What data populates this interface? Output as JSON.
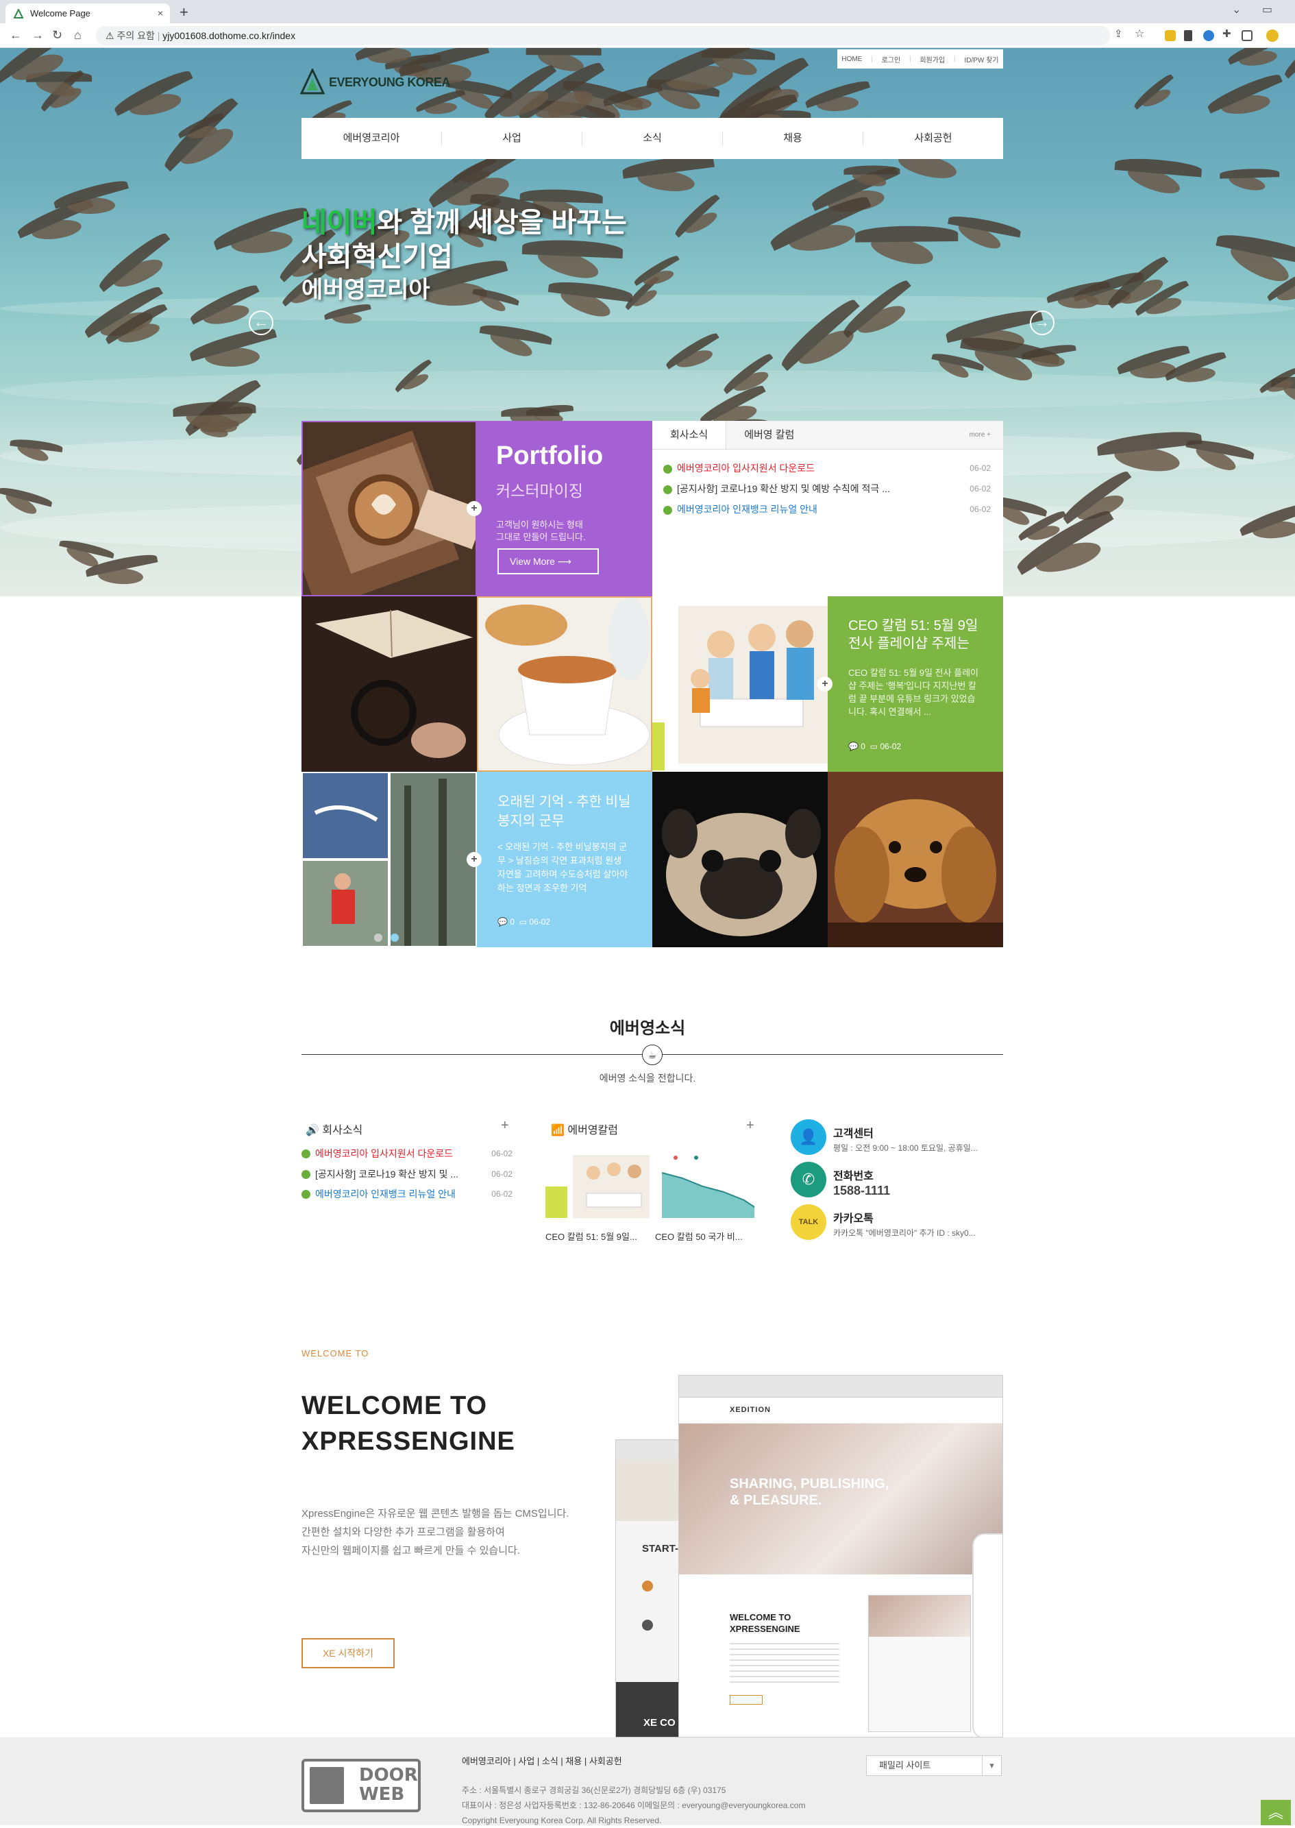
{
  "browser": {
    "tab_title": "Welcome Page",
    "close": "×",
    "new_tab": "+",
    "security_label": "주의 요함",
    "url": "yjy001608.dothome.co.kr/index",
    "nav_icons": [
      "back-icon",
      "forward-icon",
      "reload-icon",
      "home-icon"
    ],
    "window_icons": [
      "minimize-icon",
      "restore-icon"
    ]
  },
  "top_util": [
    "HOME",
    "로그인",
    "회원가입",
    "ID/PW 찾기"
  ],
  "logo_text": "EVERYOUNG KOREA",
  "gnb": [
    "에버영코리아",
    "사업",
    "소식",
    "채용",
    "사회공헌"
  ],
  "slogan": {
    "naver": "네이버",
    "line1_rest": "와 함께 세상을 바꾸는",
    "line2": "사회혁신기업",
    "line3": "에버영코리아"
  },
  "slider": {
    "prev": "←",
    "next": "→"
  },
  "portfolio": {
    "title": "Portfolio",
    "subtitle": "커스터마이징",
    "desc_line1": "고객님이 원하시는 형태",
    "desc_line2": "그대로 만들어 드립니다.",
    "button": "View More ⟶"
  },
  "news_tabs": {
    "tab1": "회사소식",
    "tab2": "에버영 칼럼",
    "more": "more +"
  },
  "news": [
    {
      "title": "에버영코리아 입사지원서 다운로드",
      "date": "06-02",
      "color": "red"
    },
    {
      "title": "[공지사항] 코로나19 확산 방지 및 예방 수칙에 적극 ...",
      "date": "06-02",
      "color": "black"
    },
    {
      "title": "에버영코리아 인재뱅크 리뉴얼 안내",
      "date": "06-02",
      "color": "blue"
    }
  ],
  "ceo_card": {
    "title": "CEO 칼럼 51: 5월 9일 전사 플레이샵 주제는",
    "desc": "CEO 칼럼 51: 5월 9일 전사 플레이샵 주제는 '행복'입니다 지지난번 칼럼 끝 부분에 유튜브 링크가 있었습니다. 혹시 연결해서 ...",
    "comments": "0",
    "date": "06-02"
  },
  "memory_card": {
    "title": "오래된 기억 - 추한 비닐봉지의 군무",
    "desc": "< 오래된 기억 - 추한 비닐봉지의 군무 > 날짐승의 각연 표과처럼 원생 자연을 고려하며 수도승처럼 살아야 하는 정면과 조우한 기억",
    "comments": "0",
    "date": "06-02"
  },
  "section_news": {
    "title": "에버영소식",
    "subtitle": "에버영 소식을 전합니다.",
    "col1_head": "회사소식",
    "col2_head": "에버영칼럼",
    "plus": "+",
    "items": [
      {
        "title": "에버영코리아 입사지원서 다운로드",
        "date": "06-02",
        "color": "red"
      },
      {
        "title": "[공지사항] 코로나19 확산 방지 및 ...",
        "date": "06-02",
        "color": "black"
      },
      {
        "title": "에버영코리아 인재뱅크 리뉴얼 안내",
        "date": "06-02",
        "color": "blue"
      }
    ],
    "thumb1_cap": "CEO 칼럼 51: 5월 9일...",
    "thumb2_cap": "CEO 칼럼 50 국가 비..."
  },
  "contact": {
    "cs_title": "고객센터",
    "cs_desc": "평일 : 오전 9:00 ~ 18:00 토요일, 공휴일...",
    "phone_title": "전화번호",
    "phone": "1588-1111",
    "kakao_title": "카카오톡",
    "kakao_desc": "카카오톡 \"에버영코리아\" 추가 ID : sky0...",
    "kakao_badge": "TALK"
  },
  "welcome": {
    "tag": "WELCOME TO",
    "title_l1": "WELCOME TO",
    "title_l2": "XPRESSENGINE",
    "desc_l1": "XpressEngine은 자유로운 웹 콘텐츠 발행을 돕는 CMS입니다.",
    "desc_l2": "간편한 설치와 다양한 추가 프로그램을 활용하여",
    "desc_l3": "자신만의 웹페이지를 쉽고 빠르게 만들 수 있습니다.",
    "button": "XE 시작하기"
  },
  "mockup": {
    "brand": "XEDITION",
    "hero_l1": "SHARING, PUBLISHING,",
    "hero_l2": "& PLEASURE.",
    "welcome_small_l1": "WELCOME TO",
    "welcome_small_l2": "XPRESSENGINE",
    "start": "START-",
    "xe_co": "XE CO"
  },
  "footer": {
    "logo_l1": "DOOR",
    "logo_l2": "WEB",
    "links": "에버영코리아  |  사업  |  소식  |  채용  |  사회공헌",
    "addr": "주소 : 서울특별시 종로구 경희궁길 36(신문로2가) 경희당빌딩 6층 (우) 03175",
    "ceo": "대표이사 : 정은성 사업자등록번호 : 132-86-20646 이메일문의 : everyoung@everyoungkorea.com",
    "copy": "Copyright Everyoung Korea Corp. All Rights Reserved.",
    "family_site": "패밀리 사이트",
    "to_top": "︽"
  },
  "colors": {
    "purple": "#a560d4",
    "green": "#7db643",
    "sky": "#8dd3f3",
    "accent": "#d6893a"
  }
}
